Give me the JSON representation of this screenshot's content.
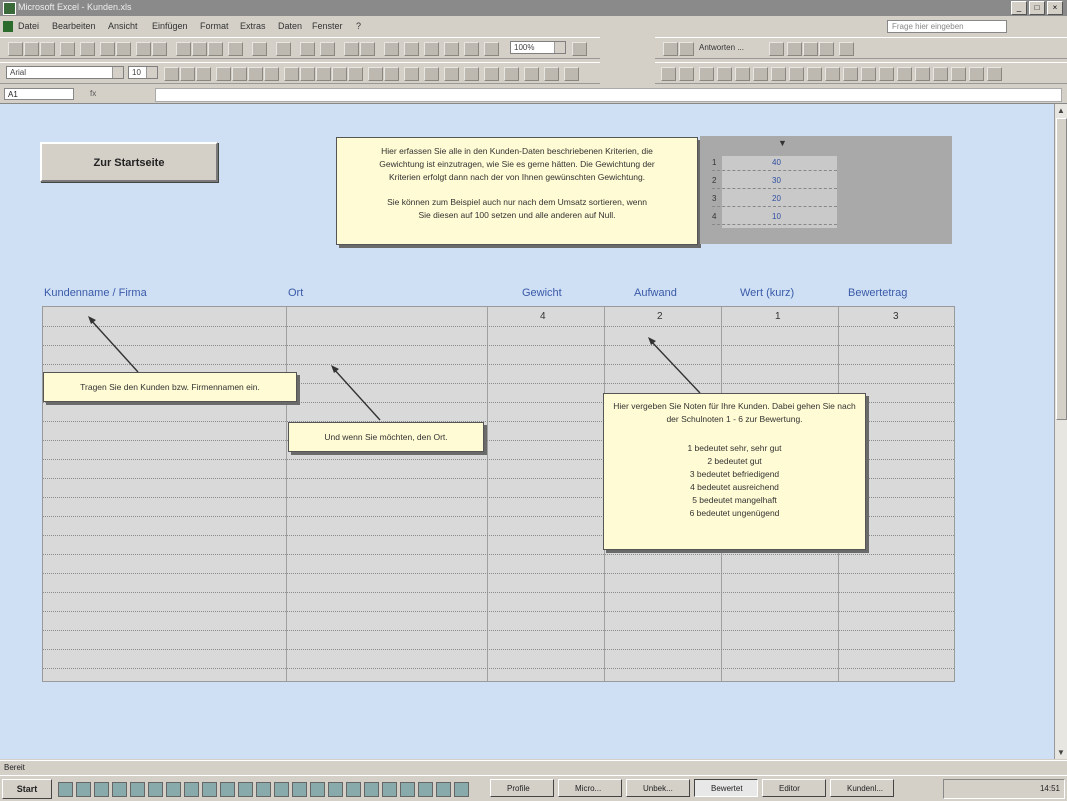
{
  "window": {
    "title": "Microsoft Excel - Kunden.xls",
    "buttons": [
      "_",
      "□",
      "×"
    ]
  },
  "menubar": {
    "items": [
      "Datei",
      "Bearbeiten",
      "Ansicht",
      "Einfügen",
      "Format",
      "Extras",
      "Daten",
      "Fenster",
      "?"
    ],
    "help_placeholder": "Frage hier eingeben"
  },
  "toolbar": {
    "zoom": "100%",
    "font_name": "Arial",
    "font_size": "10",
    "review_label": "Antworten ..."
  },
  "formula_bar": {
    "cell_ref": "A1",
    "fx": "fx",
    "value": ""
  },
  "sheet": {
    "start_button_label": "Zur Startseite",
    "intro_note": {
      "line1": "Hier erfassen Sie alle in den Kunden-Daten beschriebenen Kriterien, die",
      "line2": "Gewichtung ist einzutragen, wie Sie es gerne hätten. Die Gewichtung der",
      "line3": "Kriterien erfolgt dann nach der von Ihnen gewünschten Gewichtung.",
      "line4": "Sie können zum Beispiel auch nur nach dem Umsatz sortieren, wenn",
      "line5": "Sie diesen auf 100 setzen und alle anderen auf Null."
    },
    "scale": [
      {
        "k": "1",
        "v": "40"
      },
      {
        "k": "2",
        "v": "30"
      },
      {
        "k": "3",
        "v": "20"
      },
      {
        "k": "4",
        "v": "10"
      }
    ],
    "columns": [
      "Kundenname / Firma",
      "Ort",
      "Gewicht",
      "Aufwand",
      "Wert (kurz)",
      "Bewertetrag"
    ],
    "weights": [
      "4",
      "2",
      "1",
      "3"
    ],
    "note_name": "Tragen Sie den Kunden bzw. Firmennamen ein.",
    "note_ort": "Und wenn Sie möchten, den Ort.",
    "note_rating": {
      "intro": "Hier vergeben Sie Noten für Ihre Kunden. Dabei gehen Sie nach der Schulnoten 1 - 6 zur Bewertung.",
      "grades": [
        "1 bedeutet sehr, sehr gut",
        "2 bedeutet gut",
        "3 bedeutet befriedigend",
        "4 bedeutet ausreichend",
        "5 bedeutet mangelhaft",
        "6 bedeutet ungenügend"
      ]
    }
  },
  "statusbar": {
    "text": "Bereit"
  },
  "taskbar": {
    "start": "Start",
    "tasks": [
      "Profile",
      "Micro...",
      "Unbek...",
      "Bewertet",
      "Editor",
      "Kundenl..."
    ],
    "clock": "14:51"
  },
  "colors": {
    "sheet_bg": "#cfe0f5",
    "note_bg": "#fffbd4",
    "header_text": "#3a5aa8"
  }
}
